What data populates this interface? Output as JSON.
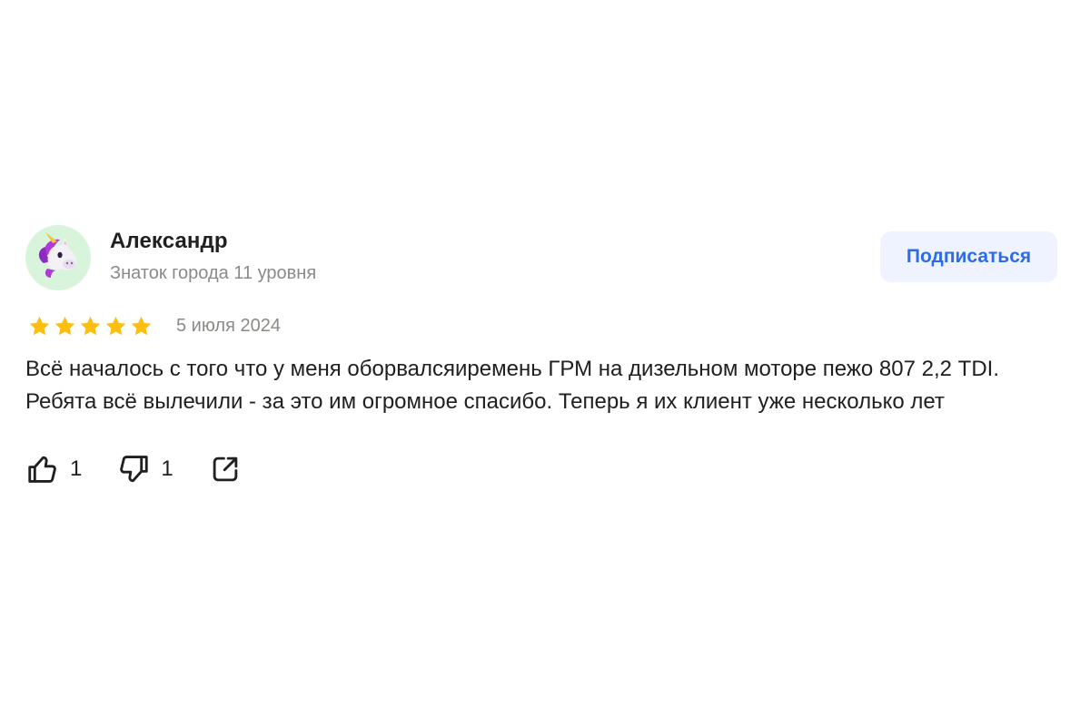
{
  "author": {
    "name": "Александр",
    "level": "Знаток города 11 уровня",
    "avatar_icon": "unicorn-emoji"
  },
  "subscribe": {
    "label": "Подписаться"
  },
  "rating": {
    "value": 5,
    "max": 5,
    "color": "#fcbf10"
  },
  "date": "5 июля 2024",
  "text": "Всё началось с того что у меня оборвалсяиремень ГРМ на дизельном моторе пежо 807 2,2 TDI. Ребята всё вылечили - за это им огромное спасибо. Теперь я их клиент уже несколько лет",
  "reactions": {
    "likes": "1",
    "dislikes": "1"
  },
  "colors": {
    "accent": "#2e6be6",
    "subscribe_bg": "#eef3ff",
    "secondary_text": "#8c8a87",
    "avatar_bg": "#d8f5dc"
  },
  "icons": {
    "like": "thumbs-up-icon",
    "dislike": "thumbs-down-icon",
    "share": "share-icon",
    "star": "star-icon"
  }
}
